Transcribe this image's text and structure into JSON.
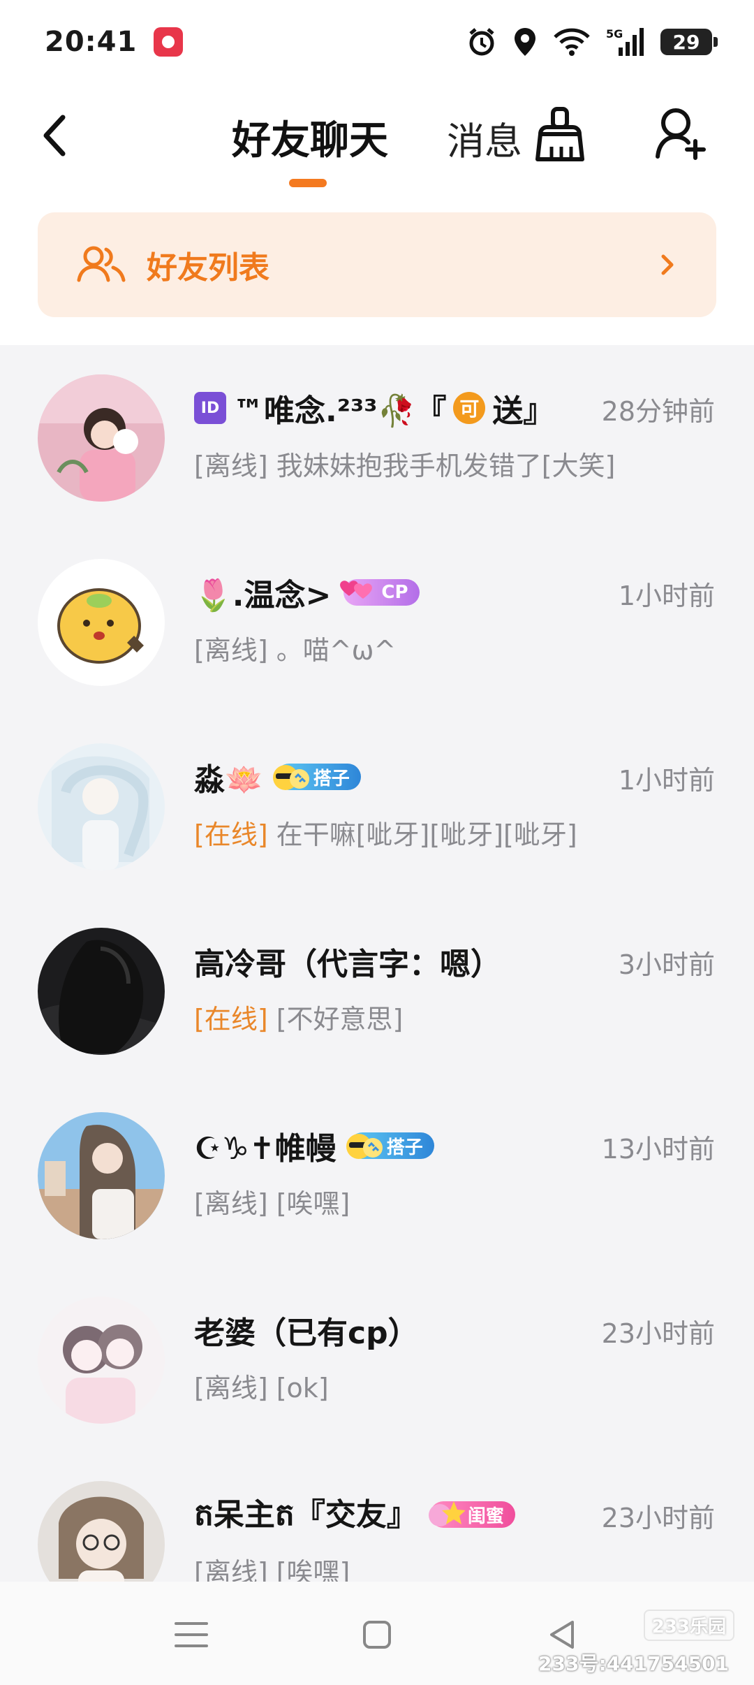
{
  "status_bar": {
    "time": "20:41",
    "battery": "29"
  },
  "header": {
    "tab_active": "好友聊天",
    "tab_inactive": "消息"
  },
  "banner": {
    "label": "好友列表"
  },
  "colors": {
    "accent": "#f47a20",
    "banner_bg": "#fdeee3",
    "online": "#e9872a",
    "muted": "#8a8a8f",
    "list_bg": "#f4f4f6"
  },
  "chats": [
    {
      "name_prefix_icon": "id-icon",
      "name": "™唯念.²³³🥀『",
      "name_chip": "可",
      "name_suffix": "送』",
      "time": "28分钟前",
      "status": "[离线]",
      "message": " 我妹妹抱我手机发错了[大笑]",
      "online": false
    },
    {
      "name": "🌷.温念>",
      "badge": "CP",
      "time": "1小时前",
      "status": "[离线]",
      "message": " 。喵^ω^",
      "online": false
    },
    {
      "name": "淼🪷",
      "badge": "搭子",
      "time": "1小时前",
      "status": "[在线]",
      "message": " 在干嘛[呲牙][呲牙][呲牙]",
      "online": true
    },
    {
      "name": "高冷哥（代言字：嗯）",
      "time": "3小时前",
      "status": "[在线]",
      "message": " [不好意思]",
      "online": true
    },
    {
      "name": "☪♑✝帷幔",
      "badge": "搭子",
      "time": "13小时前",
      "status": "[离线]",
      "message": " [唉嘿]",
      "online": false
    },
    {
      "name": "老婆（已有cp）",
      "time": "23小时前",
      "status": "[离线]",
      "message": " [ok]",
      "online": false
    },
    {
      "name": "ត呆主ត『交友』",
      "badge": "闺蜜",
      "time": "23小时前",
      "status": "[离线]",
      "message": " [唉嘿]",
      "online": false
    }
  ],
  "watermark": {
    "logo": "233乐园",
    "text": "233号:441754501"
  }
}
